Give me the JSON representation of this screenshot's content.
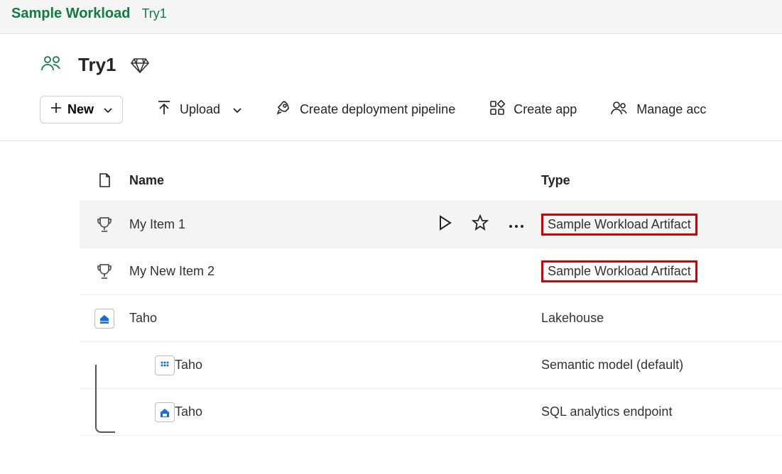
{
  "breadcrumb": {
    "app": "Sample Workload",
    "workspace": "Try1"
  },
  "workspace": {
    "title": "Try1"
  },
  "toolbar": {
    "new_label": "New",
    "upload_label": "Upload",
    "pipeline_label": "Create deployment pipeline",
    "create_app_label": "Create app",
    "manage_access_label": "Manage acc"
  },
  "table": {
    "headers": {
      "name": "Name",
      "type": "Type"
    },
    "rows": [
      {
        "name": "My Item 1",
        "type": "Sample Workload Artifact",
        "icon": "trophy",
        "hovered": true,
        "highlight_type": true,
        "child": false
      },
      {
        "name": "My New Item 2",
        "type": "Sample Workload Artifact",
        "icon": "trophy",
        "hovered": false,
        "highlight_type": true,
        "child": false
      },
      {
        "name": "Taho",
        "type": "Lakehouse",
        "icon": "lakehouse",
        "hovered": false,
        "highlight_type": false,
        "child": false
      },
      {
        "name": "Taho",
        "type": "Semantic model (default)",
        "icon": "semantic",
        "hovered": false,
        "highlight_type": false,
        "child": true
      },
      {
        "name": "Taho",
        "type": "SQL analytics endpoint",
        "icon": "sql",
        "hovered": false,
        "highlight_type": false,
        "child": true
      }
    ]
  }
}
